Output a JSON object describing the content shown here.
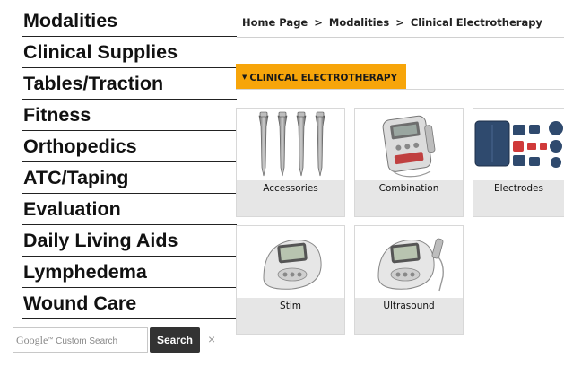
{
  "nav": {
    "items": [
      "Modalities",
      "Clinical Supplies",
      "Tables/Traction",
      "Fitness",
      "Orthopedics",
      "ATC/Taping",
      "Evaluation",
      "Daily Living Aids",
      "Lymphedema",
      "Wound Care"
    ]
  },
  "search": {
    "google_label": "Google",
    "tm_label": "™",
    "placeholder": "Custom Search",
    "button_label": "Search",
    "clear_symbol": "×"
  },
  "breadcrumb": {
    "items": [
      "Home Page",
      "Modalities",
      "Clinical Electrotherapy"
    ],
    "separator": ">"
  },
  "section": {
    "caret": "▼",
    "title": "CLINICAL ELECTROTHERAPY",
    "accent_color": "#f7a50a"
  },
  "categories": [
    {
      "label": "Accessories",
      "icon": "probe-applicators-icon"
    },
    {
      "label": "Combination",
      "icon": "combination-device-icon"
    },
    {
      "label": "Electrodes",
      "icon": "electrode-pads-icon"
    },
    {
      "label": "Stim",
      "icon": "stim-device-icon"
    },
    {
      "label": "Ultrasound",
      "icon": "ultrasound-device-icon"
    }
  ]
}
